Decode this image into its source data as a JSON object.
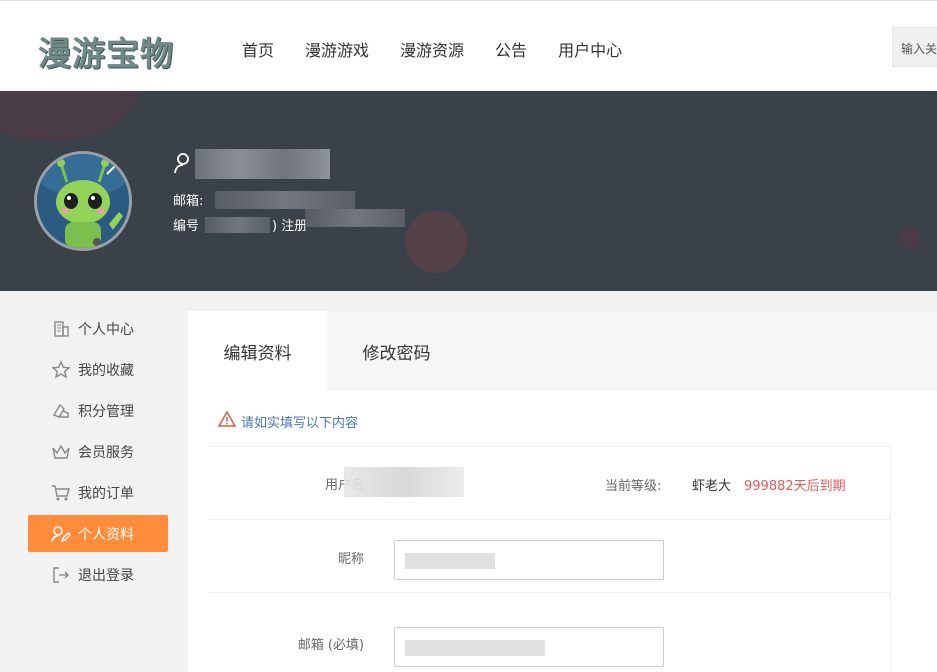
{
  "site": {
    "logo_text": "漫游宝物"
  },
  "nav": {
    "items": [
      "首页",
      "漫游游戏",
      "漫游资源",
      "公告",
      "用户中心"
    ]
  },
  "search": {
    "placeholder": "输入关"
  },
  "profile": {
    "email_label": "邮箱:",
    "id_label": "编号",
    "register_label": ") 注册"
  },
  "sidebar": {
    "items": [
      {
        "label": "个人中心",
        "icon": "building-icon"
      },
      {
        "label": "我的收藏",
        "icon": "star-icon"
      },
      {
        "label": "积分管理",
        "icon": "points-icon"
      },
      {
        "label": "会员服务",
        "icon": "crown-icon"
      },
      {
        "label": "我的订单",
        "icon": "cart-icon"
      },
      {
        "label": "个人资料",
        "icon": "user-edit-icon"
      },
      {
        "label": "退出登录",
        "icon": "logout-icon"
      }
    ],
    "active_index": 5
  },
  "tabs": [
    {
      "label": "编辑资料"
    },
    {
      "label": "修改密码"
    }
  ],
  "notice": {
    "text": "请如实填写以下内容"
  },
  "form": {
    "username_label": "用户名",
    "level_label": "当前等级:",
    "level_name": "虾老大",
    "expire_text": "999882天后到期",
    "nickname_label": "昵称",
    "email_label": "邮箱 (必填)"
  },
  "colors": {
    "accent": "#ff8c3a",
    "banner": "#3b4148",
    "expire": "#e05a5a",
    "notice": "#4a78b5"
  }
}
